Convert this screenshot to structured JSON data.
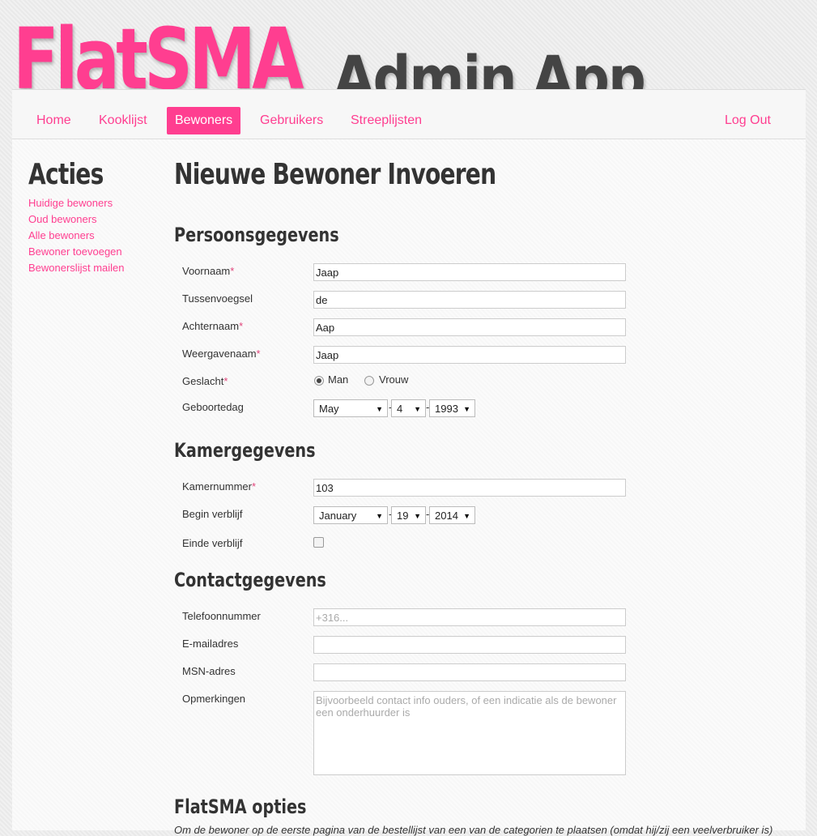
{
  "header": {
    "brand": "FlatSMA",
    "subtitle": "Admin App"
  },
  "nav": {
    "items": [
      {
        "label": "Home"
      },
      {
        "label": "Kooklijst"
      },
      {
        "label": "Bewoners"
      },
      {
        "label": "Gebruikers"
      },
      {
        "label": "Streeplijsten"
      }
    ],
    "active": "Bewoners",
    "logout": "Log Out"
  },
  "sidebar": {
    "title": "Acties",
    "links": [
      {
        "label": "Huidige bewoners"
      },
      {
        "label": "Oud bewoners"
      },
      {
        "label": "Alle bewoners"
      },
      {
        "label": "Bewoner toevoegen"
      },
      {
        "label": "Bewonerslijst mailen"
      }
    ]
  },
  "page": {
    "title": "Nieuwe Bewoner Invoeren"
  },
  "persoon": {
    "title": "Persoonsgegevens",
    "voornaam_label": "Voornaam",
    "voornaam_value": "Jaap",
    "tussenvoegsel_label": "Tussenvoegsel",
    "tussenvoegsel_value": "de",
    "achternaam_label": "Achternaam",
    "achternaam_value": "Aap",
    "weergavenaam_label": "Weergavenaam",
    "weergavenaam_value": "Jaap",
    "geslacht_label": "Geslacht",
    "gender_options": {
      "man": "Man",
      "vrouw": "Vrouw"
    },
    "gender_selected": "Man",
    "geboortedag_label": "Geboortedag",
    "birth_month": "May",
    "birth_day": "4",
    "birth_year": "1993",
    "required_mark": "*"
  },
  "kamer": {
    "title": "Kamergegevens",
    "kamernummer_label": "Kamernummer",
    "kamernummer_value": "103",
    "begin_label": "Begin verblijf",
    "begin_month": "January",
    "begin_day": "19",
    "begin_year": "2014",
    "einde_label": "Einde verblijf",
    "einde_checked": false
  },
  "contact": {
    "title": "Contactgegevens",
    "telefoon_label": "Telefoonnummer",
    "telefoon_placeholder": "+316...",
    "email_label": "E-mailadres",
    "msn_label": "MSN-adres",
    "opmerkingen_label": "Opmerkingen",
    "opmerkingen_placeholder": "Bijvoorbeeld contact info ouders, of een indicatie als de bewoner een onderhuurder is"
  },
  "opties": {
    "title": "FlatSMA opties",
    "note": "Om de bewoner op de eerste pagina van de bestellijst van een van de categorien te plaatsen (omdat hij/zij een veelverbruiker is)"
  },
  "colors": {
    "accent": "#ff3e90",
    "text": "#333333",
    "subtitle": "#444444"
  },
  "icons": {
    "dropdown": "▼"
  }
}
